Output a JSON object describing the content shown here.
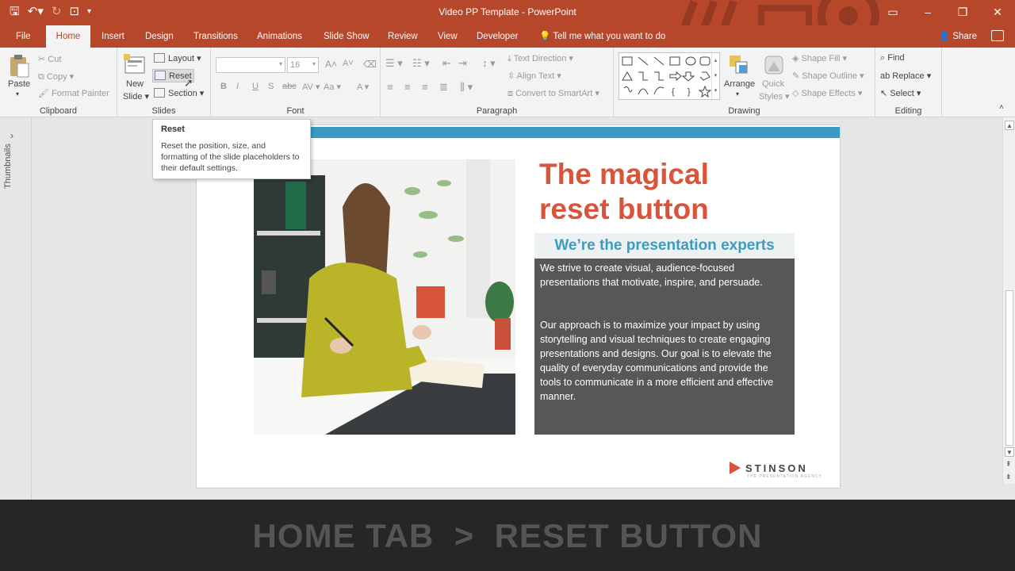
{
  "window": {
    "title": "Video PP Template - PowerPoint"
  },
  "menu": {
    "tabs": [
      "File",
      "Home",
      "Insert",
      "Design",
      "Transitions",
      "Animations",
      "Slide Show",
      "Review",
      "View",
      "Developer"
    ],
    "tell_me": "Tell me what you want to do",
    "share": "Share"
  },
  "ribbon": {
    "clipboard": {
      "label": "Clipboard",
      "paste": "Paste",
      "cut": "Cut",
      "copy": "Copy",
      "format_painter": "Format Painter"
    },
    "slides": {
      "label": "Slides",
      "new_slide_line1": "New",
      "new_slide_line2": "Slide",
      "layout": "Layout",
      "reset": "Reset",
      "section": "Section"
    },
    "font": {
      "label": "Font",
      "size": "16"
    },
    "paragraph": {
      "label": "Paragraph",
      "text_direction": "Text Direction",
      "align_text": "Align Text",
      "convert_smartart": "Convert to SmartArt"
    },
    "drawing": {
      "label": "Drawing",
      "arrange": "Arrange",
      "quick_styles_line1": "Quick",
      "quick_styles_line2": "Styles",
      "shape_fill": "Shape Fill",
      "shape_outline": "Shape Outline",
      "shape_effects": "Shape Effects"
    },
    "editing": {
      "label": "Editing",
      "find": "Find",
      "replace": "Replace",
      "select": "Select"
    }
  },
  "tooltip": {
    "title": "Reset",
    "body": "Reset the position, size, and formatting of the slide placeholders to their default settings."
  },
  "sidebar": {
    "label": "Thumbnails"
  },
  "slide": {
    "title_line1": "The magical",
    "title_line2": "reset button",
    "subtitle": "We’re the presentation experts",
    "para1": "We strive to create visual, audience-focused presentations that motivate, inspire, and persuade.",
    "para2": "Our approach is to maximize your impact by using storytelling and visual techniques to create engaging presentations and designs. Our goal is to elevate the quality of everyday communications and provide the tools to communicate in a more efficient and effective manner.",
    "logo_name": "STINSON",
    "logo_tag": "THE PRESENTATION AGENCY"
  },
  "caption": {
    "text": "HOME TAB  >  RESET BUTTON"
  },
  "colors": {
    "accent": "#b7472a",
    "title_red": "#d8543a",
    "blue": "#3a9cc2",
    "textbox_gray": "#575757"
  }
}
